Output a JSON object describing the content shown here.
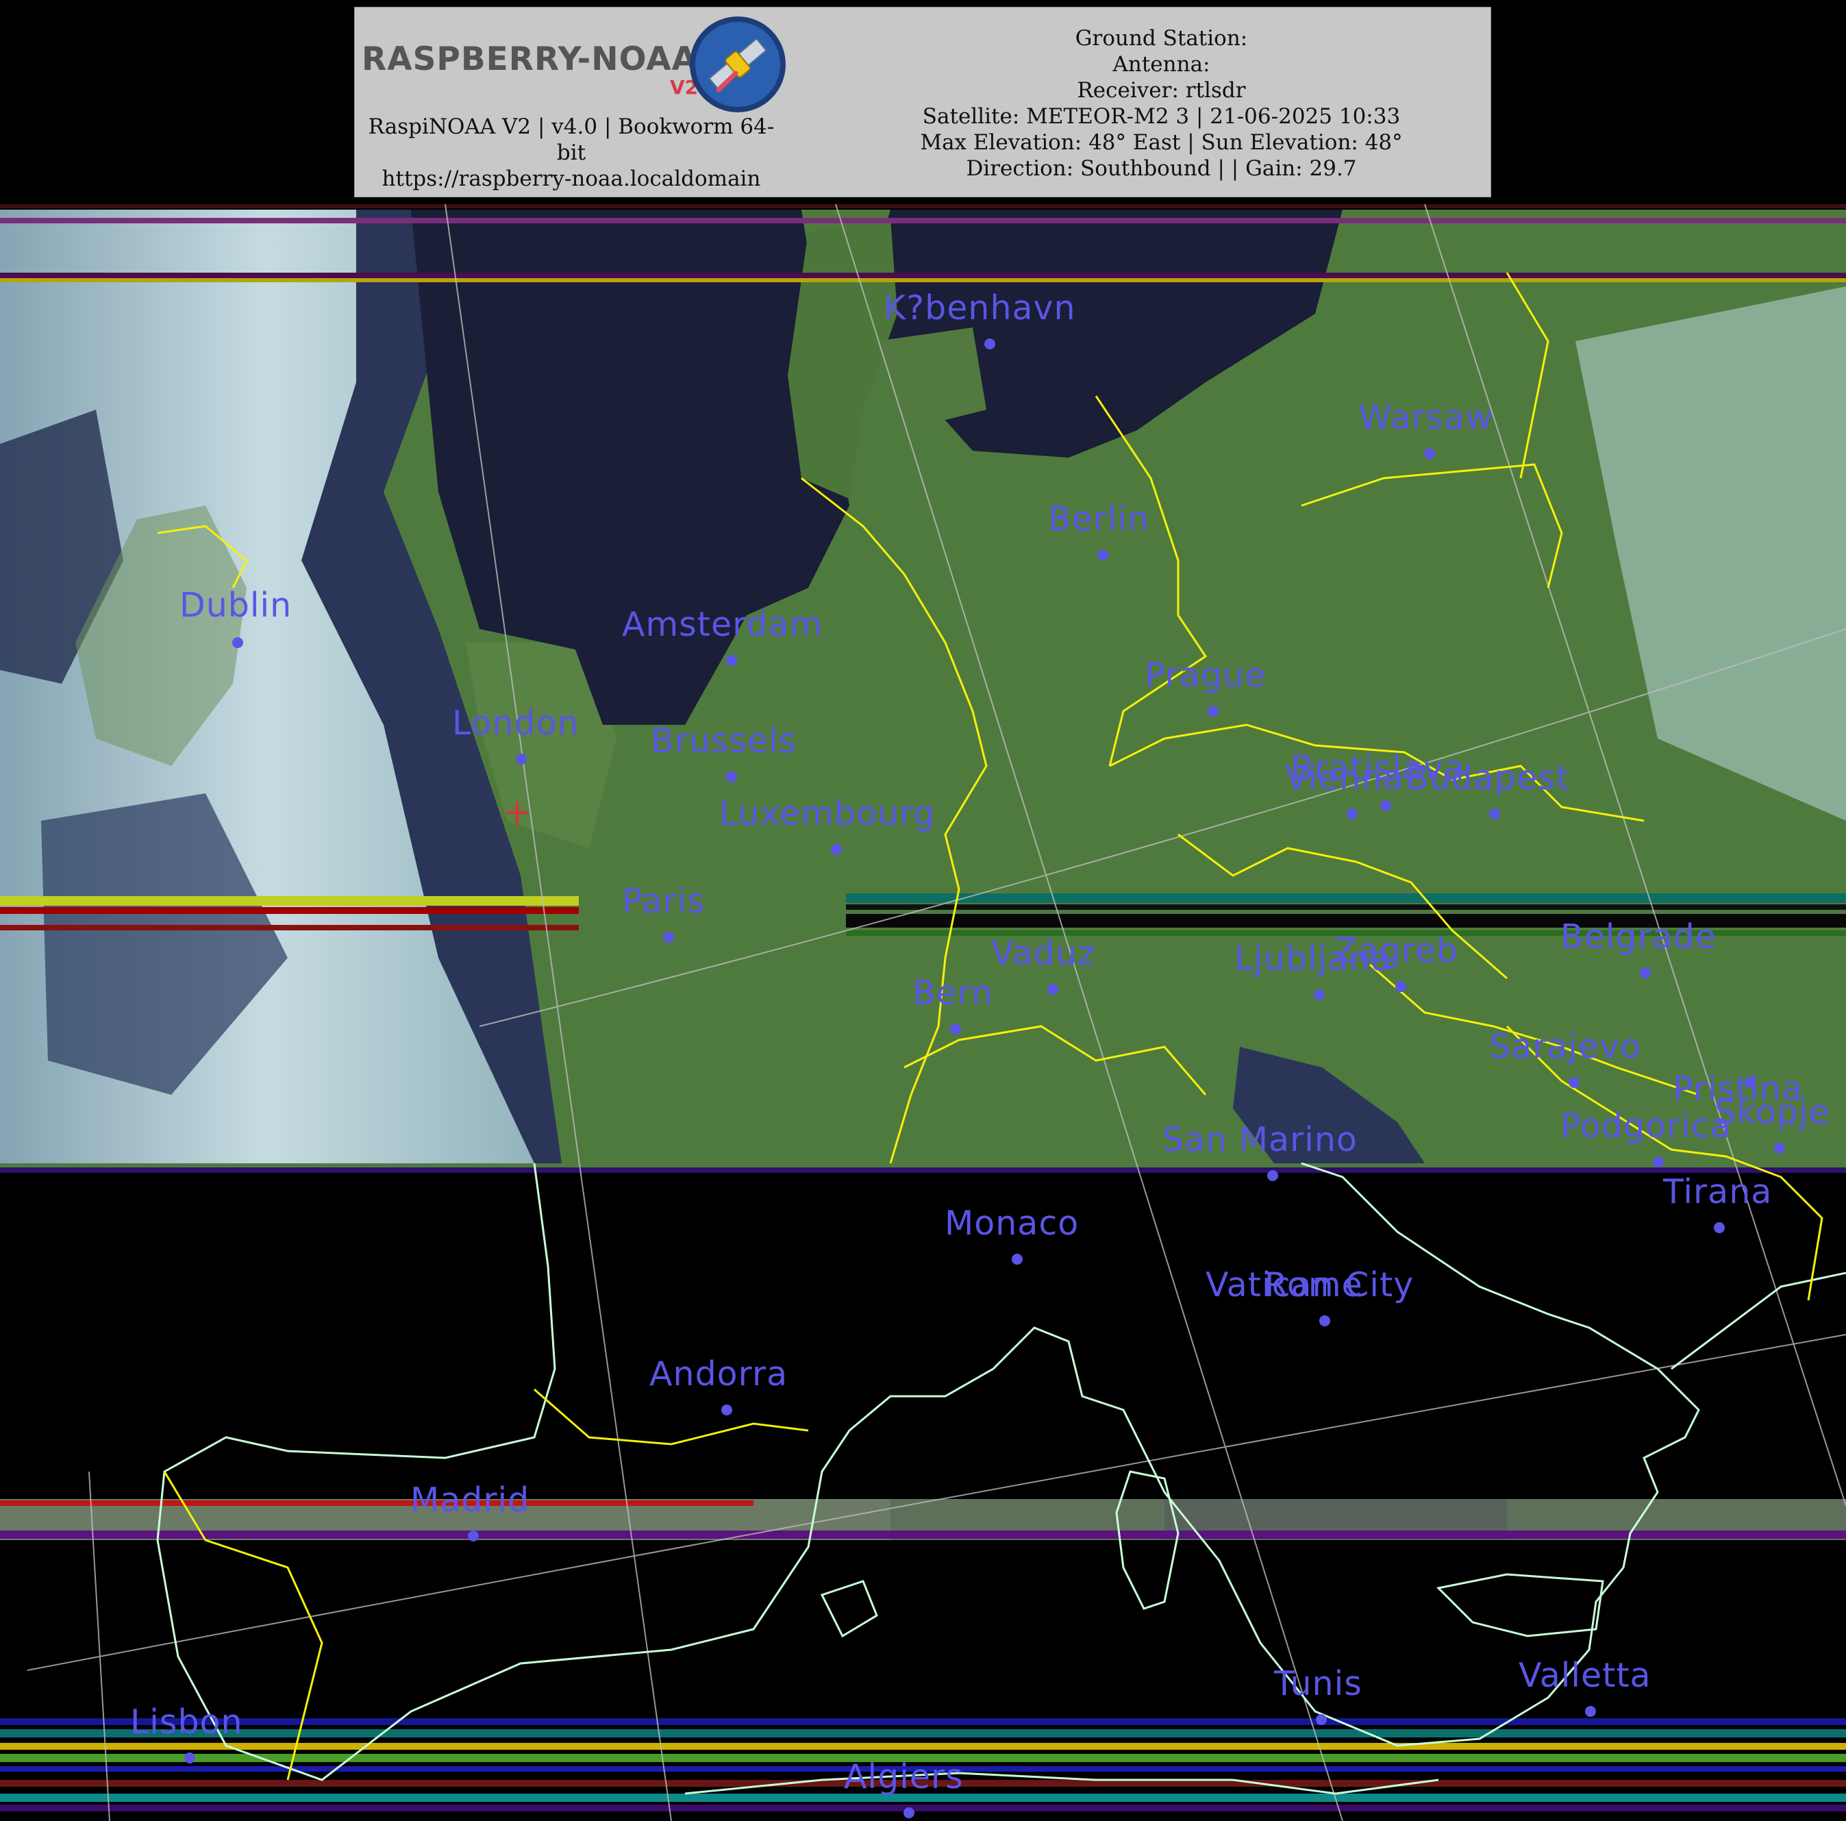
{
  "header": {
    "logo_text": "RASPBERRY-NOAA",
    "logo_version": "V2",
    "software_line1": "RaspiNOAA V2 | v4.0 | Bookworm 64-",
    "software_line2": "bit",
    "url": "https://raspberry-noaa.localdomain",
    "ground_station": "Ground Station:",
    "antenna": "Antenna:",
    "receiver": "Receiver: rtlsdr",
    "satellite": "Satellite: METEOR-M2 3 | 21-06-2025 10:33",
    "elevation": "Max Elevation: 48° East | Sun Elevation: 48°",
    "direction": "Direction: Southbound | | Gain: 29.7"
  },
  "colors": {
    "land": "#4f7a3e",
    "sea": "#1a1e36",
    "cloud": "#cfe6ea",
    "border": "#f5f00a",
    "coastline": "#c8ffd8",
    "city_label": "#5a55e6",
    "no_data": "#000000",
    "station_marker": "#e03030"
  },
  "cities": [
    {
      "name": "Dublin"
    },
    {
      "name": "London"
    },
    {
      "name": "Amsterdam"
    },
    {
      "name": "Brussels"
    },
    {
      "name": "Luxembourg"
    },
    {
      "name": "Paris"
    },
    {
      "name": "K?benhavn"
    },
    {
      "name": "Berlin"
    },
    {
      "name": "Warsaw"
    },
    {
      "name": "Prague"
    },
    {
      "name": "Vienna"
    },
    {
      "name": "Bratislava"
    },
    {
      "name": "Budapest"
    },
    {
      "name": "Vaduz"
    },
    {
      "name": "Bern"
    },
    {
      "name": "Ljubljana"
    },
    {
      "name": "Zagreb"
    },
    {
      "name": "Belgrade"
    },
    {
      "name": "Sarajevo"
    },
    {
      "name": "Pristina"
    },
    {
      "name": "Skopje"
    },
    {
      "name": "Podgorica"
    },
    {
      "name": "Tirana"
    },
    {
      "name": "San Marino"
    },
    {
      "name": "Monaco"
    },
    {
      "name": "Vatican City"
    },
    {
      "name": "Rome"
    },
    {
      "name": "Andorra"
    },
    {
      "name": "Madrid"
    },
    {
      "name": "Lisbon"
    },
    {
      "name": "Tunis"
    },
    {
      "name": "Valletta"
    },
    {
      "name": "Algiers"
    }
  ]
}
